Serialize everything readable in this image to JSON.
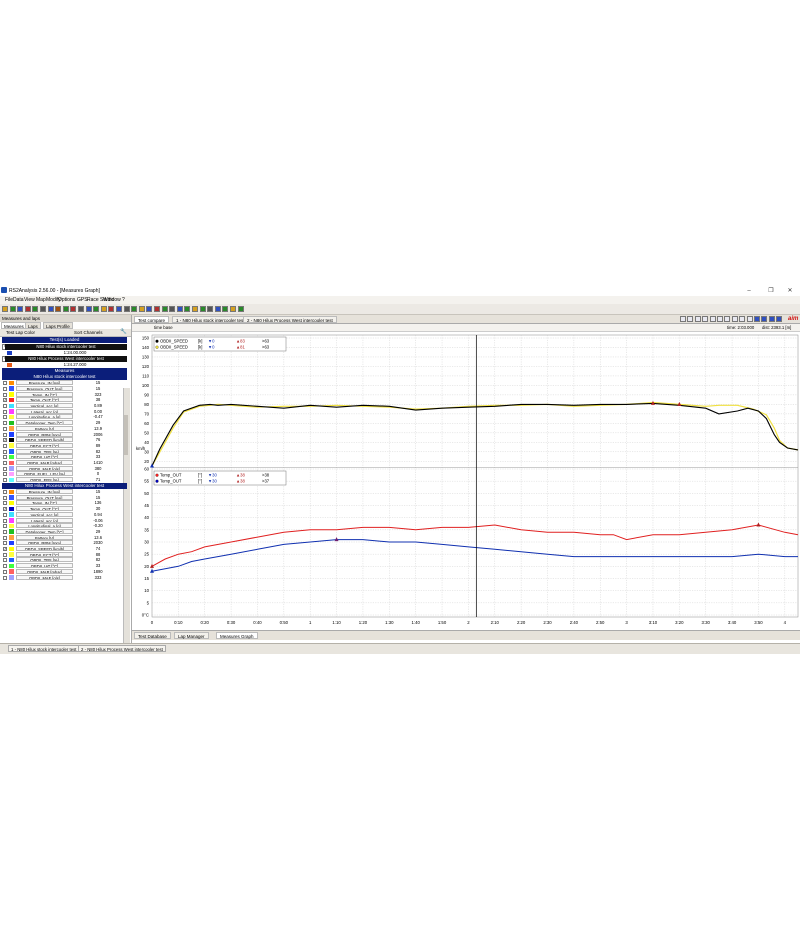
{
  "window": {
    "title": "RS2Analysis 2.56.00 - [Measures Graph]"
  },
  "menu": [
    "File",
    "Data",
    "View",
    "Map",
    "Modify",
    "Options",
    "GPS",
    "Race Studio",
    "Window",
    "?"
  ],
  "left_panel": {
    "title": "Measures and laps",
    "tabs": [
      "Measures",
      "Laps",
      "Laps Profile"
    ],
    "head_cols": [
      "Test Lap Color",
      "Sort Channels"
    ],
    "tests_loaded_label": "Test(s) Loaded",
    "tests": [
      {
        "name": "N80 Hilux stock intercooler test",
        "time": "1:24.00.000",
        "color": "#1c3fc4"
      },
      {
        "name": "N80 Hilux Process West intercooler test",
        "time": "1:24.27.000",
        "color": "#e65c1a"
      }
    ],
    "measures_label": "Measures",
    "groups": [
      {
        "header": "N80 Hilux stock intercooler test",
        "rows": [
          {
            "name": "Pressure_IN    [psi]",
            "value": "15",
            "color": "#ff8c00",
            "checked": false
          },
          {
            "name": "Pressure_OUT   [psi]",
            "value": "15",
            "color": "#3355ff",
            "checked": false
          },
          {
            "name": "Temp_IN    [°C]",
            "value": "323",
            "color": "#ffff00",
            "checked": false
          },
          {
            "name": "Temp_OUT   [°C]",
            "value": "38",
            "color": "#ff2020",
            "checked": true
          },
          {
            "name": "Vertical_acc    [g]",
            "value": "0.89",
            "color": "#40e0ff",
            "checked": false
          },
          {
            "name": "Lateral_acc    [g]",
            "value": "0.00",
            "color": "#ff40ff",
            "checked": false
          },
          {
            "name": "LongitudinA_a   [g]",
            "value": "-0.47",
            "color": "#ffff40",
            "checked": false
          },
          {
            "name": "Datalogger_Tem   [°C]",
            "value": "29",
            "color": "#20c020",
            "checked": false
          },
          {
            "name": "Battery    [V]",
            "value": "13.9",
            "color": "#ffa040",
            "checked": false
          },
          {
            "name": "OBDII_RPM    [rpm]",
            "value": "2006",
            "color": "#2040ff",
            "checked": false
          },
          {
            "name": "OBDII_SPEED   [km/h]",
            "value": "76",
            "color": "#000000",
            "checked": true
          },
          {
            "name": "OBDII_ECT   [°C]",
            "value": "89",
            "color": "#ffff40",
            "checked": false
          },
          {
            "name": "OBDII_TPS   [%]",
            "value": "82",
            "color": "#2060ff",
            "checked": false
          },
          {
            "name": "OBDII_IAT   [°C]",
            "value": "33",
            "color": "#40ff40",
            "checked": false
          },
          {
            "name": "OBDII_MAP   [mbar]",
            "value": "1410",
            "color": "#ff6060",
            "checked": false
          },
          {
            "name": "OBDII_MAF   [g/s]",
            "value": "380",
            "color": "#a0a0ff",
            "checked": false
          },
          {
            "name": "OBDII_FUEL_LEV  [%]",
            "value": "0",
            "color": "#ffa0ff",
            "checked": false
          },
          {
            "name": "OBDII_EPS    [%]",
            "value": "71",
            "color": "#60ffff",
            "checked": false
          }
        ]
      },
      {
        "header": "N80 Hilux Process West intercooler test",
        "rows": [
          {
            "name": "Pressure_IN    [psi]",
            "value": "15",
            "color": "#ff8c00",
            "checked": false
          },
          {
            "name": "Pressure_OUT   [psi]",
            "value": "15",
            "color": "#3355ff",
            "checked": false
          },
          {
            "name": "Temp_IN    [°C]",
            "value": "136",
            "color": "#ffff00",
            "checked": false
          },
          {
            "name": "Temp_OUT   [°C]",
            "value": "30",
            "color": "#0000c0",
            "checked": true
          },
          {
            "name": "Vertical_acc    [g]",
            "value": "0.94",
            "color": "#40e0ff",
            "checked": false
          },
          {
            "name": "Lateral_acc    [g]",
            "value": "-0.06",
            "color": "#ff40ff",
            "checked": false
          },
          {
            "name": "Longitudinal_a   [g]",
            "value": "-0.20",
            "color": "#ffff40",
            "checked": false
          },
          {
            "name": "Datalogger_Tem   [°C]",
            "value": "29",
            "color": "#20c020",
            "checked": false
          },
          {
            "name": "Battery    [V]",
            "value": "13.6",
            "color": "#ffa040",
            "checked": false
          },
          {
            "name": "OBDII_RPM    [rpm]",
            "value": "2030",
            "color": "#2040ff",
            "checked": false
          },
          {
            "name": "OBDII_SPEED   [km/h]",
            "value": "74",
            "color": "#ffff00",
            "checked": true
          },
          {
            "name": "OBDII_ECT   [°C]",
            "value": "88",
            "color": "#ffff40",
            "checked": false
          },
          {
            "name": "OBDII_TPS   [%]",
            "value": "82",
            "color": "#2060ff",
            "checked": false
          },
          {
            "name": "OBDII_IAT   [°C]",
            "value": "33",
            "color": "#40ff40",
            "checked": false
          },
          {
            "name": "OBDII_MAP   [mbar]",
            "value": "1890",
            "color": "#ff6060",
            "checked": false
          },
          {
            "name": "OBDII_MAF   [g/s]",
            "value": "333",
            "color": "#a0a0ff",
            "checked": false
          }
        ]
      }
    ]
  },
  "doc_tabs": [
    "Test compare",
    "1 - N80 Hilux stock intercooler test",
    "2 - N80 Hilux Process West intercooler test"
  ],
  "graph_header": {
    "left": "time base",
    "time": "time: 2:03.000",
    "dist": "dist: 2393.1 [m]"
  },
  "speed_legend": [
    {
      "name": "OBDII_SPEED",
      "unit": "[k]",
      "min": "0",
      "max": "83",
      "val": ">63",
      "color": "#000000"
    },
    {
      "name": "OBDII_SPEED",
      "unit": "[k]",
      "min": "0",
      "max": "81",
      "val": ">63",
      "color": "#f0e040"
    }
  ],
  "temp_legend": [
    {
      "name": "Temp_OUT",
      "unit": "[°]",
      "min": "30",
      "max": "38",
      "val": ">38",
      "color": "#ff2020",
      "base": "20"
    },
    {
      "name": "Temp_OUT",
      "unit": "[°]",
      "min": "30",
      "max": "38",
      "val": ">37",
      "color": "#0000c0",
      "base": "19"
    }
  ],
  "bottom_tabs": [
    "Test Database",
    "Lap Manager",
    "Measures Graph"
  ],
  "status_tabs": [
    "1 - N80 Hilux stock intercooler test",
    "2 - N80 Hilux Process West intercooler test"
  ],
  "colors": {
    "navy": "#0b1e7a",
    "speed_a": "#000000",
    "speed_b": "#f0e040",
    "temp_a": "#e02020",
    "temp_b": "#1030b0"
  },
  "chart_data": [
    {
      "type": "line",
      "title": "",
      "xlabel": "",
      "ylabel": "km/h",
      "y_ticks": [
        150,
        140,
        130,
        120,
        110,
        100,
        90,
        80,
        70,
        60,
        50,
        40,
        30,
        20
      ],
      "x_ticks": [
        "0",
        "0:10",
        "0:20",
        "0:30",
        "0:40",
        "0:50",
        "1",
        "1:10",
        "1:20",
        "1:30",
        "1:40",
        "1:50",
        "2",
        "2:10",
        "2:20",
        "2:30",
        "2:40",
        "2:50",
        "3",
        "3:10",
        "3:20",
        "3:30",
        "3:40",
        "3:50",
        "4"
      ],
      "x_unit": "seconds",
      "xlim": [
        0,
        245
      ],
      "ylim": [
        15,
        150
      ],
      "cursor_x": 123,
      "series": [
        {
          "values_x": [
            0,
            3,
            8,
            12,
            18,
            22,
            25,
            30,
            40,
            50,
            60,
            70,
            80,
            90,
            100,
            110,
            120,
            130,
            140,
            150,
            160,
            170,
            180,
            190,
            200,
            210,
            215,
            222,
            226,
            230,
            233,
            236,
            238,
            241,
            245
          ],
          "values_y": [
            15,
            33,
            58,
            73,
            79,
            80,
            79,
            80,
            78,
            76,
            79,
            77,
            79,
            78,
            74,
            76,
            77,
            78,
            80,
            80,
            79,
            80,
            80,
            81,
            79,
            76,
            70,
            73,
            76,
            73,
            65,
            48,
            40,
            34,
            32
          ]
        },
        {
          "values_x": [
            0,
            3,
            8,
            12,
            18,
            22,
            25,
            30,
            40,
            50,
            60,
            70,
            80,
            90,
            100,
            110,
            120,
            130,
            140,
            150,
            160,
            170,
            180,
            190,
            200,
            210,
            215,
            222,
            228,
            233,
            236,
            238,
            241,
            245
          ],
          "values_y": [
            15,
            30,
            55,
            72,
            78,
            79,
            80,
            79,
            77,
            78,
            78,
            79,
            78,
            77,
            75,
            76,
            78,
            79,
            79,
            80,
            78,
            79,
            80,
            82,
            80,
            78,
            79,
            79,
            75,
            69,
            55,
            42,
            34,
            32
          ]
        }
      ]
    },
    {
      "type": "line",
      "title": "",
      "xlabel": "",
      "ylabel": "°C",
      "y_ticks": [
        60,
        55,
        50,
        45,
        40,
        35,
        30,
        25,
        20,
        15,
        10,
        5,
        0
      ],
      "xlim": [
        0,
        245
      ],
      "ylim": [
        0,
        60
      ],
      "series": [
        {
          "values_x": [
            0,
            5,
            10,
            15,
            20,
            30,
            40,
            50,
            60,
            70,
            80,
            90,
            100,
            110,
            120,
            130,
            140,
            150,
            160,
            170,
            175,
            180,
            190,
            200,
            210,
            220,
            230,
            240,
            245
          ],
          "values_y": [
            20,
            23,
            25,
            26,
            28,
            30,
            32,
            34,
            35,
            35,
            36,
            36,
            35,
            36,
            36,
            37,
            35,
            34,
            34,
            33,
            33,
            31,
            33,
            33,
            34,
            35,
            37,
            34,
            33
          ]
        },
        {
          "values_x": [
            0,
            5,
            10,
            15,
            20,
            30,
            40,
            50,
            60,
            70,
            80,
            90,
            100,
            110,
            120,
            130,
            140,
            150,
            160,
            170,
            180,
            190,
            200,
            210,
            220,
            230,
            240,
            245
          ],
          "values_y": [
            18,
            19,
            20,
            22,
            23,
            25,
            27,
            29,
            30,
            31,
            31,
            30,
            30,
            29,
            28,
            27,
            26,
            25,
            24,
            24,
            24,
            24,
            24,
            24,
            24,
            25,
            24,
            24
          ]
        }
      ]
    }
  ]
}
